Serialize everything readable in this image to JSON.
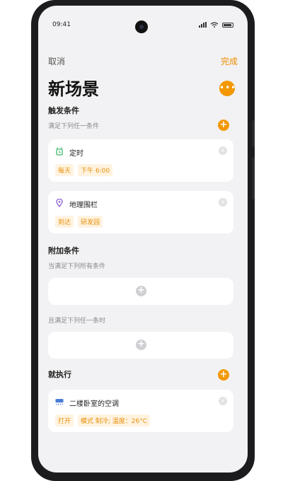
{
  "status_bar": {
    "time": "09:41"
  },
  "header": {
    "cancel_label": "取消",
    "done_label": "完成",
    "title": "新场景",
    "more_label": "•••"
  },
  "trigger_section": {
    "title": "触发条件",
    "subtitle": "满足下列任一条件",
    "add_label": "+",
    "cards": [
      {
        "name": "定时",
        "icon": "alarm-clock-icon",
        "tags": [
          "每天",
          "下午 6:00"
        ]
      },
      {
        "name": "地理围栏",
        "icon": "location-pin-icon",
        "tags": [
          "到达",
          "研发园"
        ]
      }
    ]
  },
  "extra_section": {
    "title": "附加条件",
    "subtitle_all": "当满足下列所有条件",
    "subtitle_any": "且满足下列任一条时",
    "add_label": "+"
  },
  "action_section": {
    "title": "就执行",
    "add_label": "+",
    "cards": [
      {
        "name": "二楼卧室的空调",
        "icon": "air-conditioner-icon",
        "tags": [
          "打开",
          "模式 制冷; 温度：26°C"
        ]
      }
    ]
  },
  "colors": {
    "accent": "#f39800",
    "tag_text": "#e8900a",
    "tag_bg": "#fff3e0",
    "screen_bg": "#f2f2f4"
  }
}
